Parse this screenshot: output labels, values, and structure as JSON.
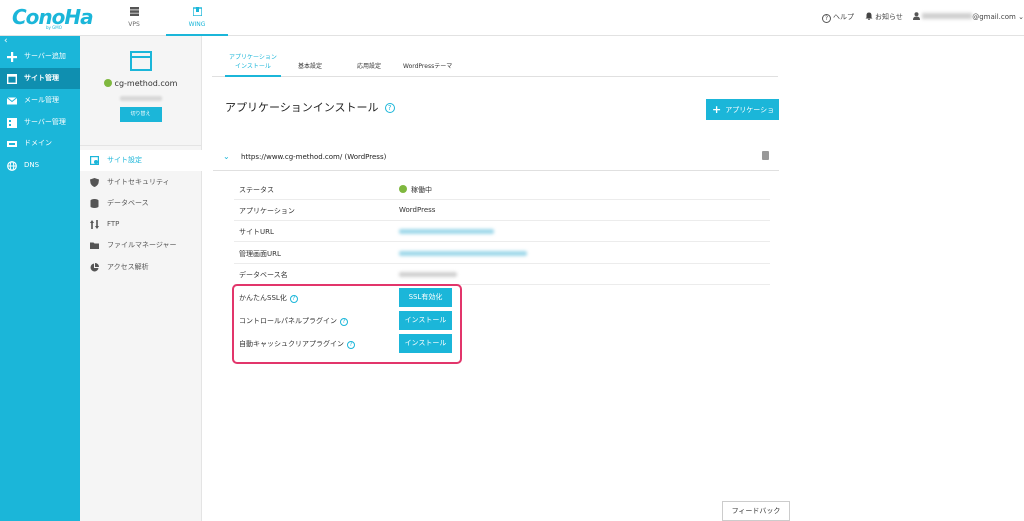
{
  "header": {
    "logo": "ConoHa",
    "logo_sub": "by GMO",
    "services": [
      {
        "label": "VPS",
        "icon": "server-icon"
      },
      {
        "label": "WING",
        "icon": "wing-icon"
      }
    ],
    "help_label": "ヘルプ",
    "notice_label": "お知らせ",
    "account_email": "@gmail.com"
  },
  "sidebar": {
    "collapse_icon": "chevron-left-icon",
    "items": [
      {
        "label": "サーバー追加",
        "icon": "plus-icon"
      },
      {
        "label": "サイト管理",
        "icon": "site-icon"
      },
      {
        "label": "メール管理",
        "icon": "mail-icon"
      },
      {
        "label": "サーバー管理",
        "icon": "server-manage-icon"
      },
      {
        "label": "ドメイン",
        "icon": "domain-icon"
      },
      {
        "label": "DNS",
        "icon": "globe-icon"
      }
    ],
    "active_index": 1
  },
  "site_panel": {
    "domain": "cg-method.com",
    "switch_label": "切り替え",
    "menu": [
      {
        "label": "サイト設定",
        "icon": "site-settings-icon"
      },
      {
        "label": "サイトセキュリティ",
        "icon": "shield-icon"
      },
      {
        "label": "データベース",
        "icon": "database-icon"
      },
      {
        "label": "FTP",
        "icon": "ftp-icon"
      },
      {
        "label": "ファイルマネージャー",
        "icon": "folder-icon"
      },
      {
        "label": "アクセス解析",
        "icon": "pie-chart-icon"
      }
    ]
  },
  "tabs": [
    {
      "label": "アプリケーション\nインストール"
    },
    {
      "label": "基本設定"
    },
    {
      "label": "応用設定"
    },
    {
      "label": "WordPressテーマ"
    }
  ],
  "main": {
    "title": "アプリケーションインストール",
    "add_button": "アプリケーション",
    "app_url": "https://www.cg-method.com/ (WordPress)",
    "rows": [
      {
        "key": "ステータス",
        "value": "稼働中"
      },
      {
        "key": "アプリケーション",
        "value": "WordPress"
      },
      {
        "key": "サイトURL",
        "value": ""
      },
      {
        "key": "管理画面URL",
        "value": ""
      },
      {
        "key": "データベース名",
        "value": ""
      },
      {
        "key": "かんたんSSL化",
        "value": "SSL有効化"
      },
      {
        "key": "コントロールパネルプラグイン",
        "value": "インストール"
      },
      {
        "key": "自動キャッシュクリアプラグイン",
        "value": "インストール"
      }
    ],
    "feedback": "フィードバック"
  },
  "colors": {
    "accent": "#1bb6d9",
    "active_nav": "#0f8fb0",
    "status_ok": "#7fb83f",
    "highlight": "#e2356b"
  }
}
